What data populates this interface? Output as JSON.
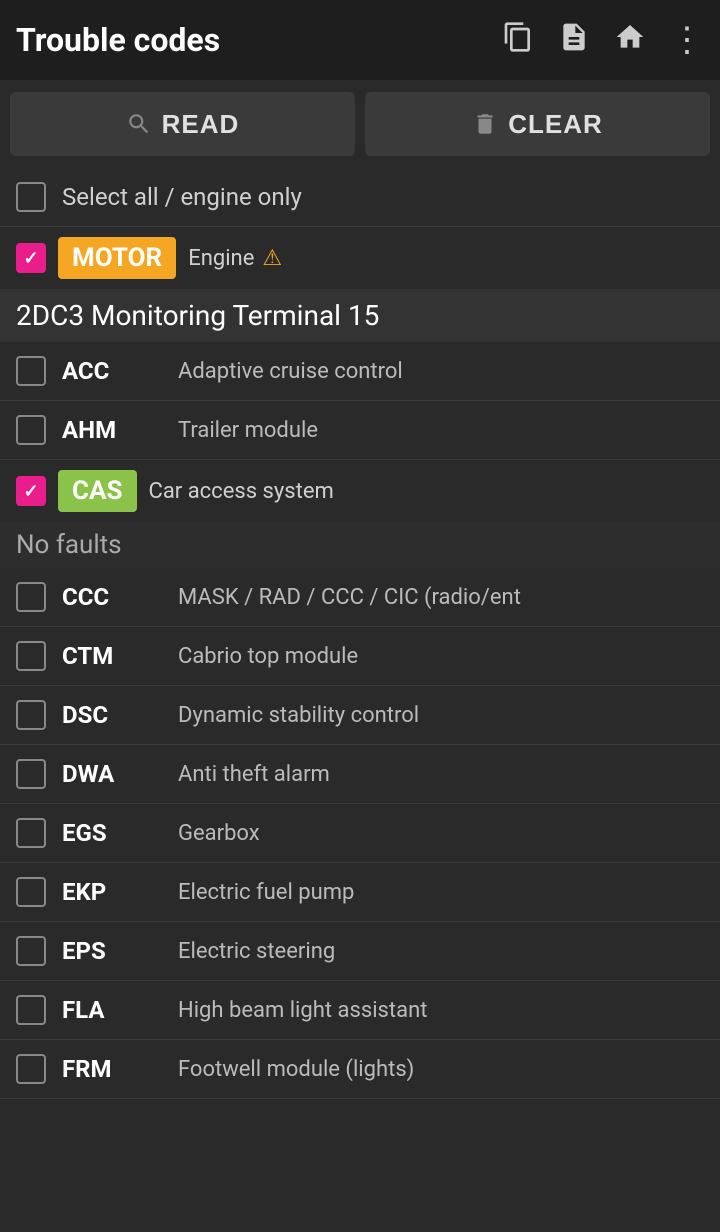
{
  "header": {
    "title": "Trouble codes",
    "icons": {
      "copy": "⧉",
      "file": "📄",
      "home": "🏠",
      "more": "⋮"
    }
  },
  "actions": {
    "read_label": "READ",
    "clear_label": "CLEAR"
  },
  "select_all": {
    "label": "Select all / engine only"
  },
  "modules": [
    {
      "tag": "MOTOR",
      "tag_class": "tag-motor",
      "description": "Engine",
      "has_warning": true,
      "checked": true,
      "group_label": "2DC3 Monitoring Terminal 15",
      "no_faults": false,
      "items": [
        {
          "code": "ACC",
          "desc": "Adaptive cruise control",
          "checked": false
        },
        {
          "code": "AHM",
          "desc": "Trailer module",
          "checked": false
        }
      ]
    },
    {
      "tag": "CAS",
      "tag_class": "tag-cas",
      "description": "Car access system",
      "has_warning": false,
      "checked": true,
      "no_faults": true,
      "no_faults_text": "No faults",
      "items": [
        {
          "code": "CCC",
          "desc": "MASK / RAD / CCC / CIC (radio/ent",
          "checked": false
        },
        {
          "code": "CTM",
          "desc": "Cabrio top module",
          "checked": false
        },
        {
          "code": "DSC",
          "desc": "Dynamic stability control",
          "checked": false
        },
        {
          "code": "DWA",
          "desc": "Anti theft alarm",
          "checked": false
        },
        {
          "code": "EGS",
          "desc": "Gearbox",
          "checked": false
        },
        {
          "code": "EKP",
          "desc": "Electric fuel pump",
          "checked": false
        },
        {
          "code": "EPS",
          "desc": "Electric steering",
          "checked": false
        },
        {
          "code": "FLA",
          "desc": "High beam light assistant",
          "checked": false
        },
        {
          "code": "FRM",
          "desc": "Footwell module (lights)",
          "checked": false
        }
      ]
    }
  ]
}
